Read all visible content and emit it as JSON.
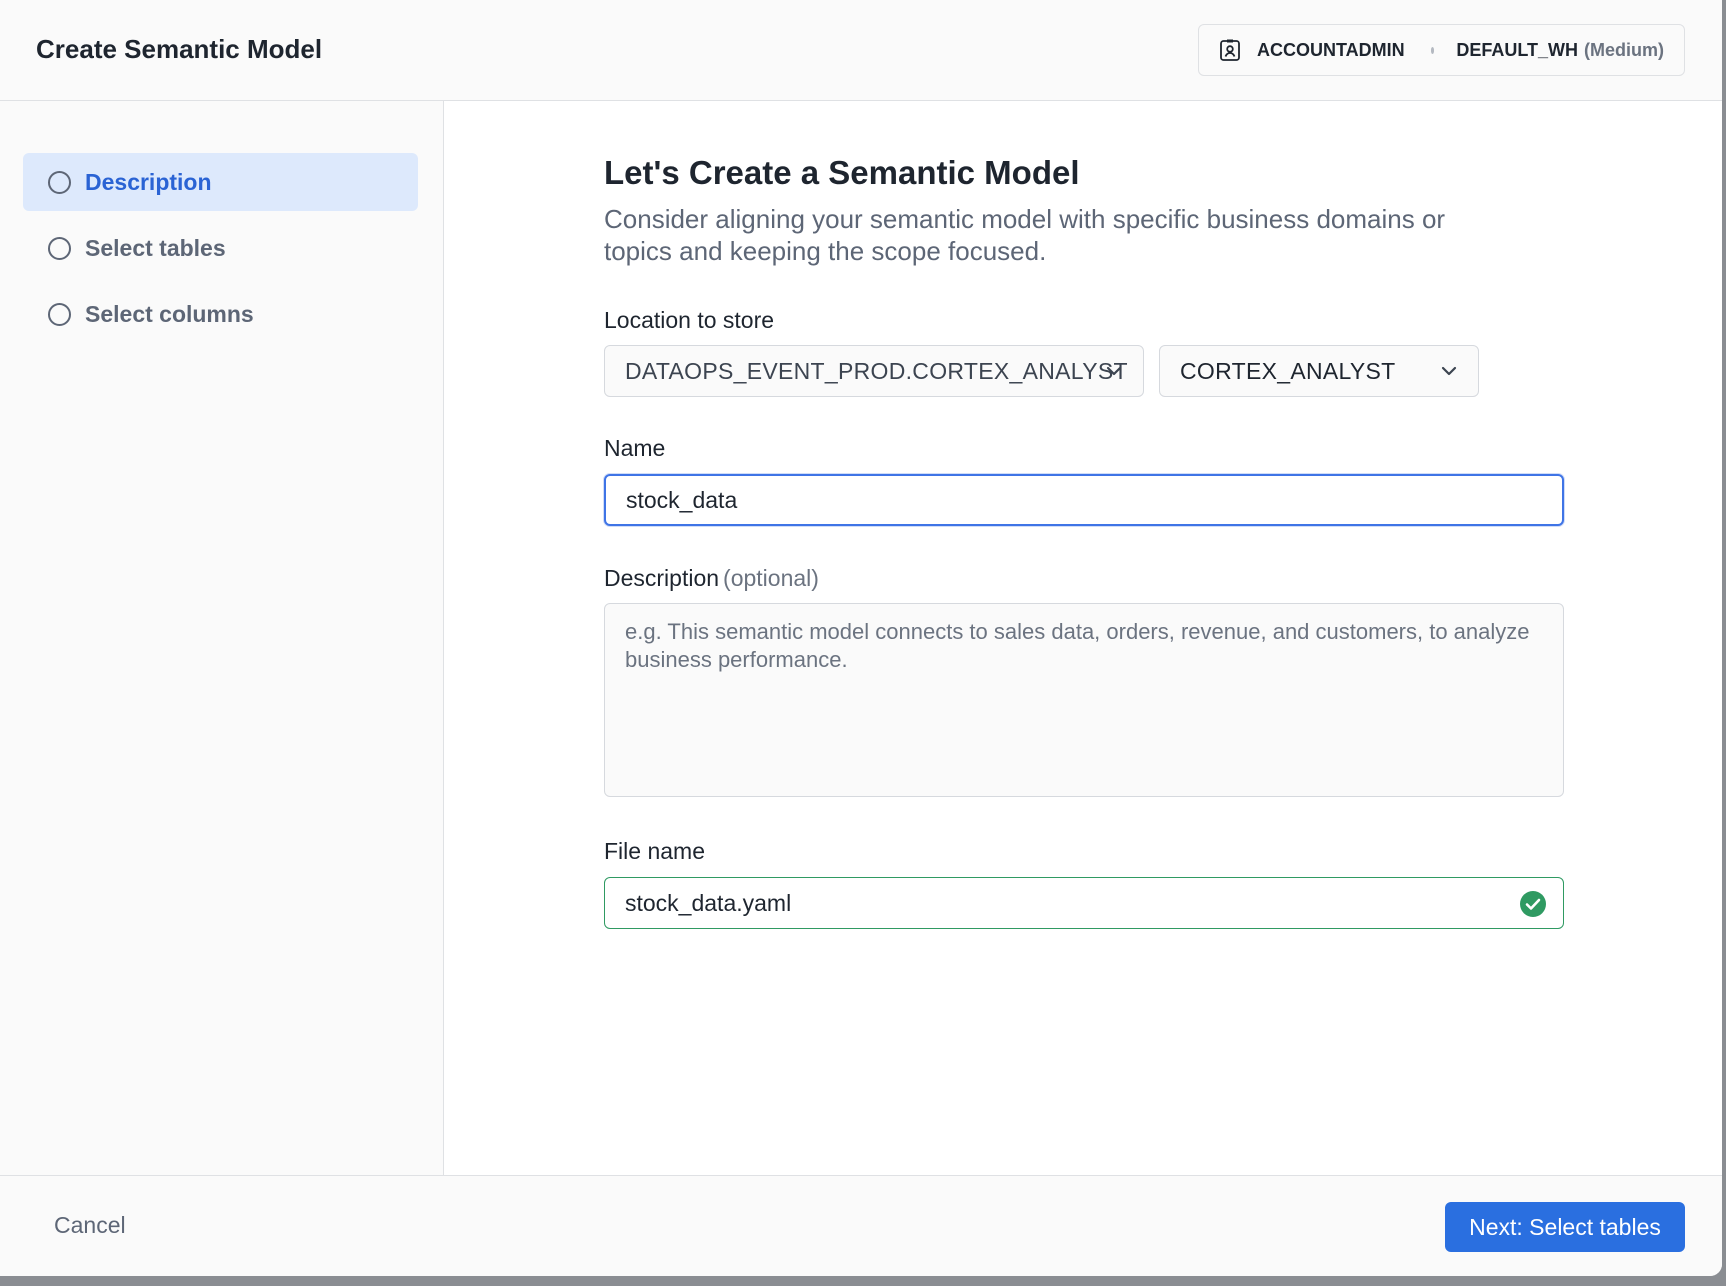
{
  "header": {
    "title": "Create Semantic Model",
    "role": "ACCOUNTADMIN",
    "warehouse": "DEFAULT_WH",
    "warehouse_size": "(Medium)"
  },
  "sidebar": {
    "steps": [
      {
        "label": "Description",
        "active": true
      },
      {
        "label": "Select tables",
        "active": false
      },
      {
        "label": "Select columns",
        "active": false
      }
    ]
  },
  "main": {
    "title": "Let's Create a Semantic Model",
    "subtitle": "Consider aligning your semantic model with specific business domains or topics and keeping the scope focused.",
    "location_label": "Location to store",
    "location_database": "DATAOPS_EVENT_PROD.CORTEX_ANALYST",
    "location_schema": "CORTEX_ANALYST",
    "name_label": "Name",
    "name_value": "stock_data",
    "description_label": "Description",
    "description_optional": "(optional)",
    "description_placeholder": "e.g. This semantic model connects to sales data, orders, revenue, and customers, to analyze business performance.",
    "file_name_label": "File name",
    "file_name_value": "stock_data.yaml"
  },
  "footer": {
    "cancel_label": "Cancel",
    "next_label": "Next: Select tables"
  },
  "colors": {
    "accent": "#2a6fe0",
    "active_step_bg": "#dde9fc",
    "valid": "#2f9a62"
  }
}
